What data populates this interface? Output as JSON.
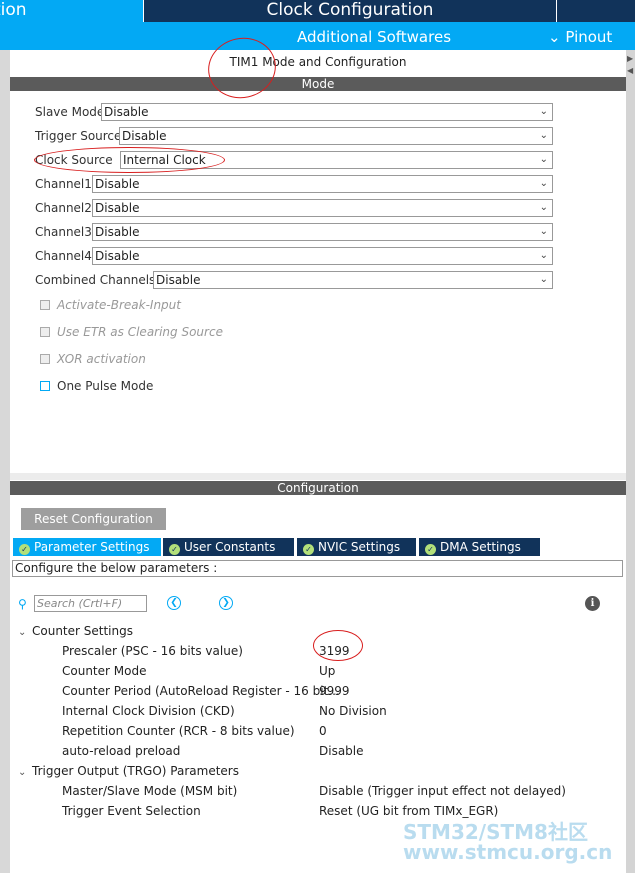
{
  "top_tabs": {
    "left_tab": "tion",
    "center_tab": "Clock Configuration"
  },
  "subbar": {
    "additional_softwares": "Additional Softwares",
    "pinout": "Pinout"
  },
  "mode_panel": {
    "title": "TIM1 Mode and Configuration",
    "section": "Mode",
    "rows": [
      {
        "label": "Slave Mode",
        "value": "Disable"
      },
      {
        "label": "Trigger Source",
        "value": "Disable"
      },
      {
        "label": "Clock Source",
        "value": "Internal Clock"
      },
      {
        "label": "Channel1",
        "value": "Disable"
      },
      {
        "label": "Channel2",
        "value": "Disable"
      },
      {
        "label": "Channel3",
        "value": "Disable"
      },
      {
        "label": "Channel4",
        "value": "Disable"
      },
      {
        "label": "Combined Channels",
        "value": "Disable"
      }
    ],
    "checkboxes": [
      {
        "label": "Activate-Break-Input"
      },
      {
        "label": "Use ETR as Clearing Source"
      },
      {
        "label": "XOR activation"
      },
      {
        "label": "One Pulse Mode"
      }
    ]
  },
  "config_panel": {
    "section": "Configuration",
    "reset_button": "Reset Configuration",
    "tabs": [
      "Parameter Settings",
      "User Constants",
      "NVIC Settings",
      "DMA Settings"
    ],
    "hint": "Configure the below parameters :",
    "search_placeholder": "Search (Crtl+F)",
    "groups": [
      {
        "name": "Counter Settings",
        "params": [
          {
            "name": "Prescaler (PSC - 16 bits value)",
            "value": "3199"
          },
          {
            "name": "Counter Mode",
            "value": "Up"
          },
          {
            "name": "Counter Period (AutoReload Register - 16 bit...",
            "value": "9999"
          },
          {
            "name": "Internal Clock Division (CKD)",
            "value": "No Division"
          },
          {
            "name": "Repetition Counter (RCR - 8 bits value)",
            "value": "0"
          },
          {
            "name": "auto-reload preload",
            "value": "Disable"
          }
        ]
      },
      {
        "name": "Trigger Output (TRGO) Parameters",
        "params": [
          {
            "name": "Master/Slave Mode (MSM bit)",
            "value": "Disable (Trigger input effect not delayed)"
          },
          {
            "name": "Trigger Event Selection",
            "value": "Reset (UG bit from TIMx_EGR)"
          }
        ]
      }
    ]
  },
  "watermark": {
    "line1": "STM32/STM8社区",
    "line2": "www.stmcu.org.cn"
  },
  "colors": {
    "accent": "#03a9f4",
    "navy": "#11335a",
    "annotation": "#d81e1e"
  }
}
